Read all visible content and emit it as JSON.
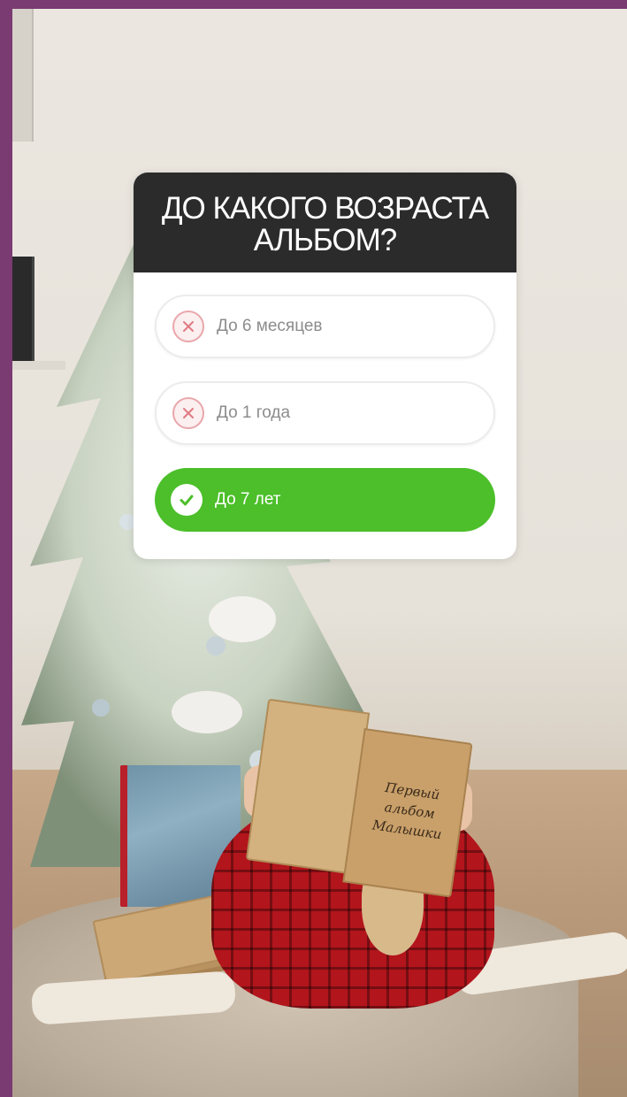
{
  "poll": {
    "question": "ДО КАКОГО ВОЗРАСТА АЛЬБОМ?",
    "options": [
      {
        "label": "До 6 месяцев",
        "state": "wrong",
        "icon": "x-circle-icon"
      },
      {
        "label": "До 1 года",
        "state": "wrong",
        "icon": "x-circle-icon"
      },
      {
        "label": "До 7 лет",
        "state": "correct",
        "icon": "check-circle-icon"
      }
    ],
    "colors": {
      "header_bg": "#2b2b2b",
      "correct": "#4cbf2a",
      "wrong_icon": "#e9a7ab"
    }
  },
  "album": {
    "title": "Первый альбом Малышки"
  },
  "frame": {
    "border_color": "#7a3a72"
  }
}
